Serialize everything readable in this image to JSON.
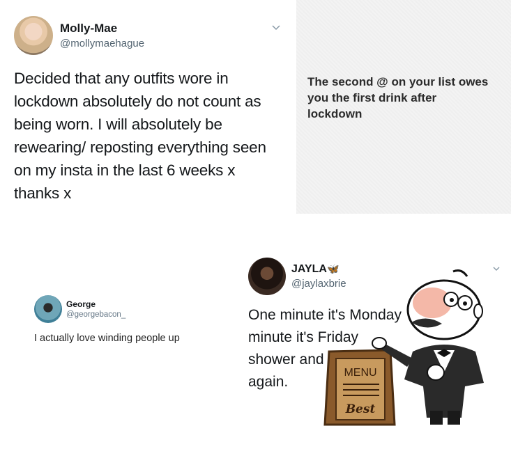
{
  "tweet1": {
    "name": "Molly-Mae",
    "handle": "@mollymaehague",
    "lines": [
      "Decided that any outfits wore in",
      "lockdown absolutely do not count as",
      "being worn. I will absolutely be",
      "rewearing/ reposting everything seen",
      "on my insta in the last 6 weeks x",
      "thanks x"
    ]
  },
  "card2": {
    "lines": [
      "The second @ on your list owes",
      "you the first drink after",
      "lockdown"
    ]
  },
  "tweet3": {
    "name": "George",
    "handle": "@georgebacon_",
    "text": "I actually love winding people up"
  },
  "tweet4": {
    "name": "JAYLA",
    "name_emoji": "🦋",
    "handle": "@jaylaxbrie",
    "lines": [
      "One minute it's Monday",
      "minute it's Friday",
      "shower and",
      "again."
    ]
  },
  "chef_overlay": {
    "sign_title": "MENU",
    "sign_caption": "Best"
  },
  "colors": {
    "handle": "#536471",
    "card_bg": "#f3f3f3",
    "chef_jacket": "#2a2a2a",
    "sign_wood": "#8a5a2b"
  }
}
